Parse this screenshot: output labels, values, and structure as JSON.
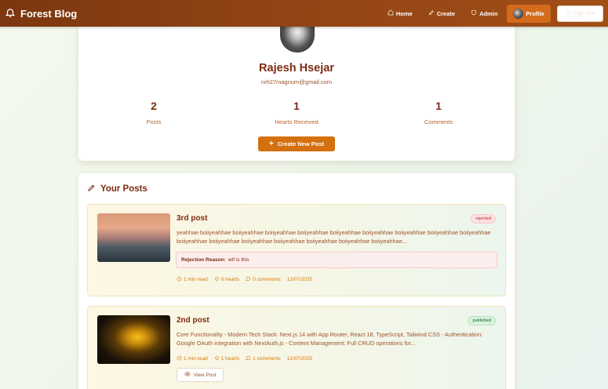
{
  "nav": {
    "brand": "Forest Blog",
    "links": [
      {
        "label": "Home",
        "icon": "home-icon"
      },
      {
        "label": "Create",
        "icon": "pen-icon"
      },
      {
        "label": "Admin",
        "icon": "shield-icon"
      },
      {
        "label": "Profile",
        "icon": "avatar"
      }
    ],
    "signout": "Sign Out"
  },
  "profile": {
    "name": "Rajesh Hsejar",
    "email": "nrh27magnum@gmail.com",
    "stats": [
      {
        "value": "2",
        "label": "Posts"
      },
      {
        "value": "1",
        "label": "Hearts Received"
      },
      {
        "value": "1",
        "label": "Comments"
      }
    ],
    "create_button": "Create New Post"
  },
  "posts_section": {
    "title": "Your Posts",
    "posts": [
      {
        "title": "3rd post",
        "status": "rejected",
        "excerpt": "yeahhae boiiyeahhae boiiyeahhae boiiyeahhae boiiyeahhae boiiyeahhae boiiyeahhae boiiyeahhae boiiyeahhae boiiyeahhae boiiyeahhae boiiyeahhae boiiyeahhae boiiyeahhae boiiyeahhae boiiyeahhae boiiyeahhae...",
        "rejection_label": "Rejection Reason:",
        "rejection_reason": "wtf is this",
        "read_time": "1 min read",
        "hearts": "0 hearts",
        "comments": "0 comments",
        "date": "12/07/2025"
      },
      {
        "title": "2nd post",
        "status": "published",
        "excerpt": "Core Functionality - Modern Tech Stack: Next.js 14 with App Router, React 18, TypeScript, Tailwind CSS - Authentication: Google OAuth integration with NextAuth.js - Content Management: Full CRUD operations for...",
        "read_time": "1 min read",
        "hearts": "1 hearts",
        "comments": "1 comments",
        "date": "12/07/2025",
        "view_button": "View Post"
      }
    ]
  },
  "colors": {
    "nav_bg": "#8f4314",
    "accent": "#d4700f",
    "text_primary": "#7c2d12",
    "rejected": "#b91c1c",
    "published": "#166534"
  }
}
